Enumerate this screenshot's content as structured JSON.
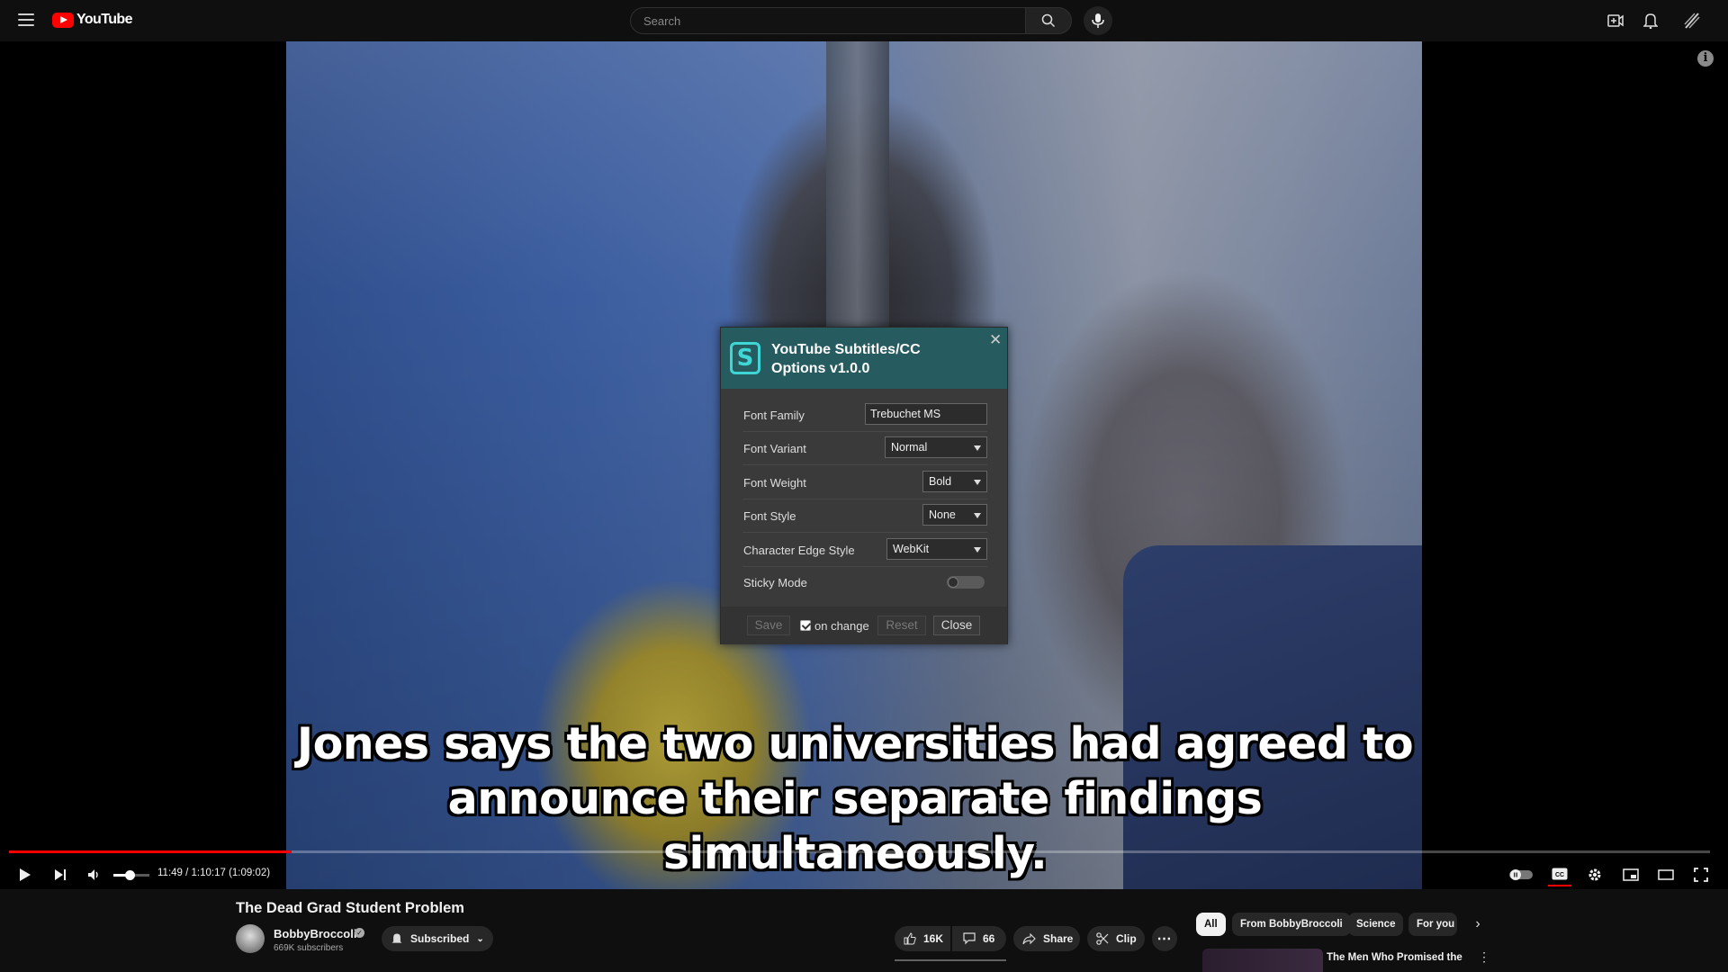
{
  "header": {
    "logo_text": "YouTube",
    "search_placeholder": "Search"
  },
  "video": {
    "subtitle_lines": [
      "Jones says the two universities had agreed to",
      "announce their separate findings simultaneously."
    ],
    "played_fraction": 0.166
  },
  "player": {
    "time": "11:49 / 1:10:17 (1:09:02)",
    "volume_fraction": 0.45
  },
  "dialog": {
    "title": "YouTube Subtitles/CC Options v1.0.0",
    "logo_letter": "S",
    "close_symbol": "✕",
    "fields": {
      "font_family": {
        "label": "Font Family",
        "value": "Trebuchet MS"
      },
      "font_variant": {
        "label": "Font Variant",
        "value": "Normal"
      },
      "font_weight": {
        "label": "Font Weight",
        "value": "Bold"
      },
      "font_style": {
        "label": "Font Style",
        "value": "None"
      },
      "edge_style": {
        "label": "Character Edge Style",
        "value": "WebKit"
      },
      "sticky_mode": {
        "label": "Sticky Mode",
        "enabled": false
      }
    },
    "footer": {
      "save": "Save",
      "on_change": "on change",
      "on_change_checked": true,
      "reset": "Reset",
      "close": "Close"
    }
  },
  "below": {
    "title": "The Dead Grad Student Problem",
    "channel": "BobbyBroccoli",
    "subscribers": "669K subscribers",
    "subscribed": "Subscribed",
    "likes": "16K",
    "comments": "66",
    "share": "Share",
    "clip": "Clip",
    "chips": [
      "All",
      "From BobbyBroccoli",
      "Science",
      "For you"
    ],
    "rec_title": "The Men Who Promised the"
  },
  "colors": {
    "accent": "#ff0000",
    "dialog_header": "#265b60",
    "dialog_logo": "#3fd6d6"
  }
}
